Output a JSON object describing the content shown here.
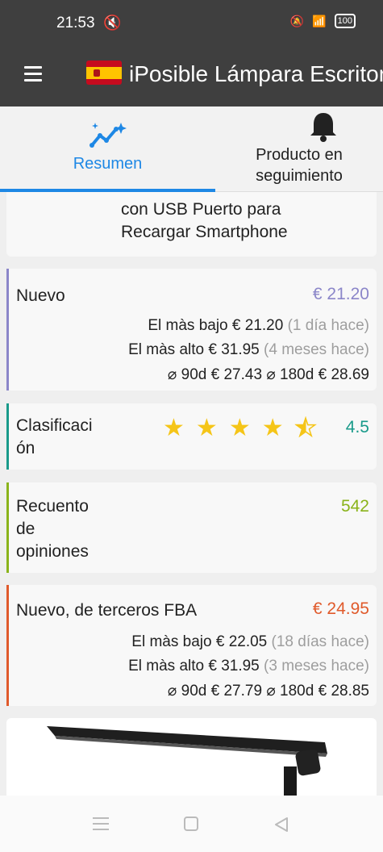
{
  "status_bar": {
    "time": "21:53",
    "battery": "100"
  },
  "app_bar": {
    "title": "iPosible Lámpara Escritorio"
  },
  "tabs": [
    {
      "label": "Resumen",
      "active": true
    },
    {
      "label": "Producto en seguimiento",
      "active": false
    }
  ],
  "title_card": {
    "line1": "con USB Puerto para",
    "line2": "Recargar Smartphone"
  },
  "new_price": {
    "label": "Nuevo",
    "price": "€ 21.20",
    "color": "#8b86c9",
    "low_label": "El màs bajo",
    "low_price": "€ 21.20",
    "low_when": "(1 día hace)",
    "high_label": "El màs alto",
    "high_price": "€ 31.95",
    "high_when": "(4 meses hace)",
    "avg90_label": "⌀ 90d",
    "avg90": "€ 27.43",
    "avg180_label": "⌀ 180d",
    "avg180": "€ 28.69"
  },
  "rating": {
    "label_line1": "Clasificaci",
    "label_line2": "ón",
    "value": "4.5",
    "stars": 4.5,
    "color": "#199a8a"
  },
  "reviews": {
    "label_line1": "Recuento",
    "label_line2": "de",
    "label_line3": "opiniones",
    "value": "542",
    "color": "#8ab31a"
  },
  "third_party_fba": {
    "label": "Nuevo, de terceros FBA",
    "price": "€ 24.95",
    "color": "#e05a2b",
    "low_label": "El màs bajo",
    "low_price": "€ 22.05",
    "low_when": "(18 días hace)",
    "high_label": "El màs alto",
    "high_price": "€ 31.95",
    "high_when": "(3 meses hace)",
    "avg90_label": "⌀ 90d",
    "avg90": "€ 27.79",
    "avg180_label": "⌀ 180d",
    "avg180": "€ 28.85"
  }
}
